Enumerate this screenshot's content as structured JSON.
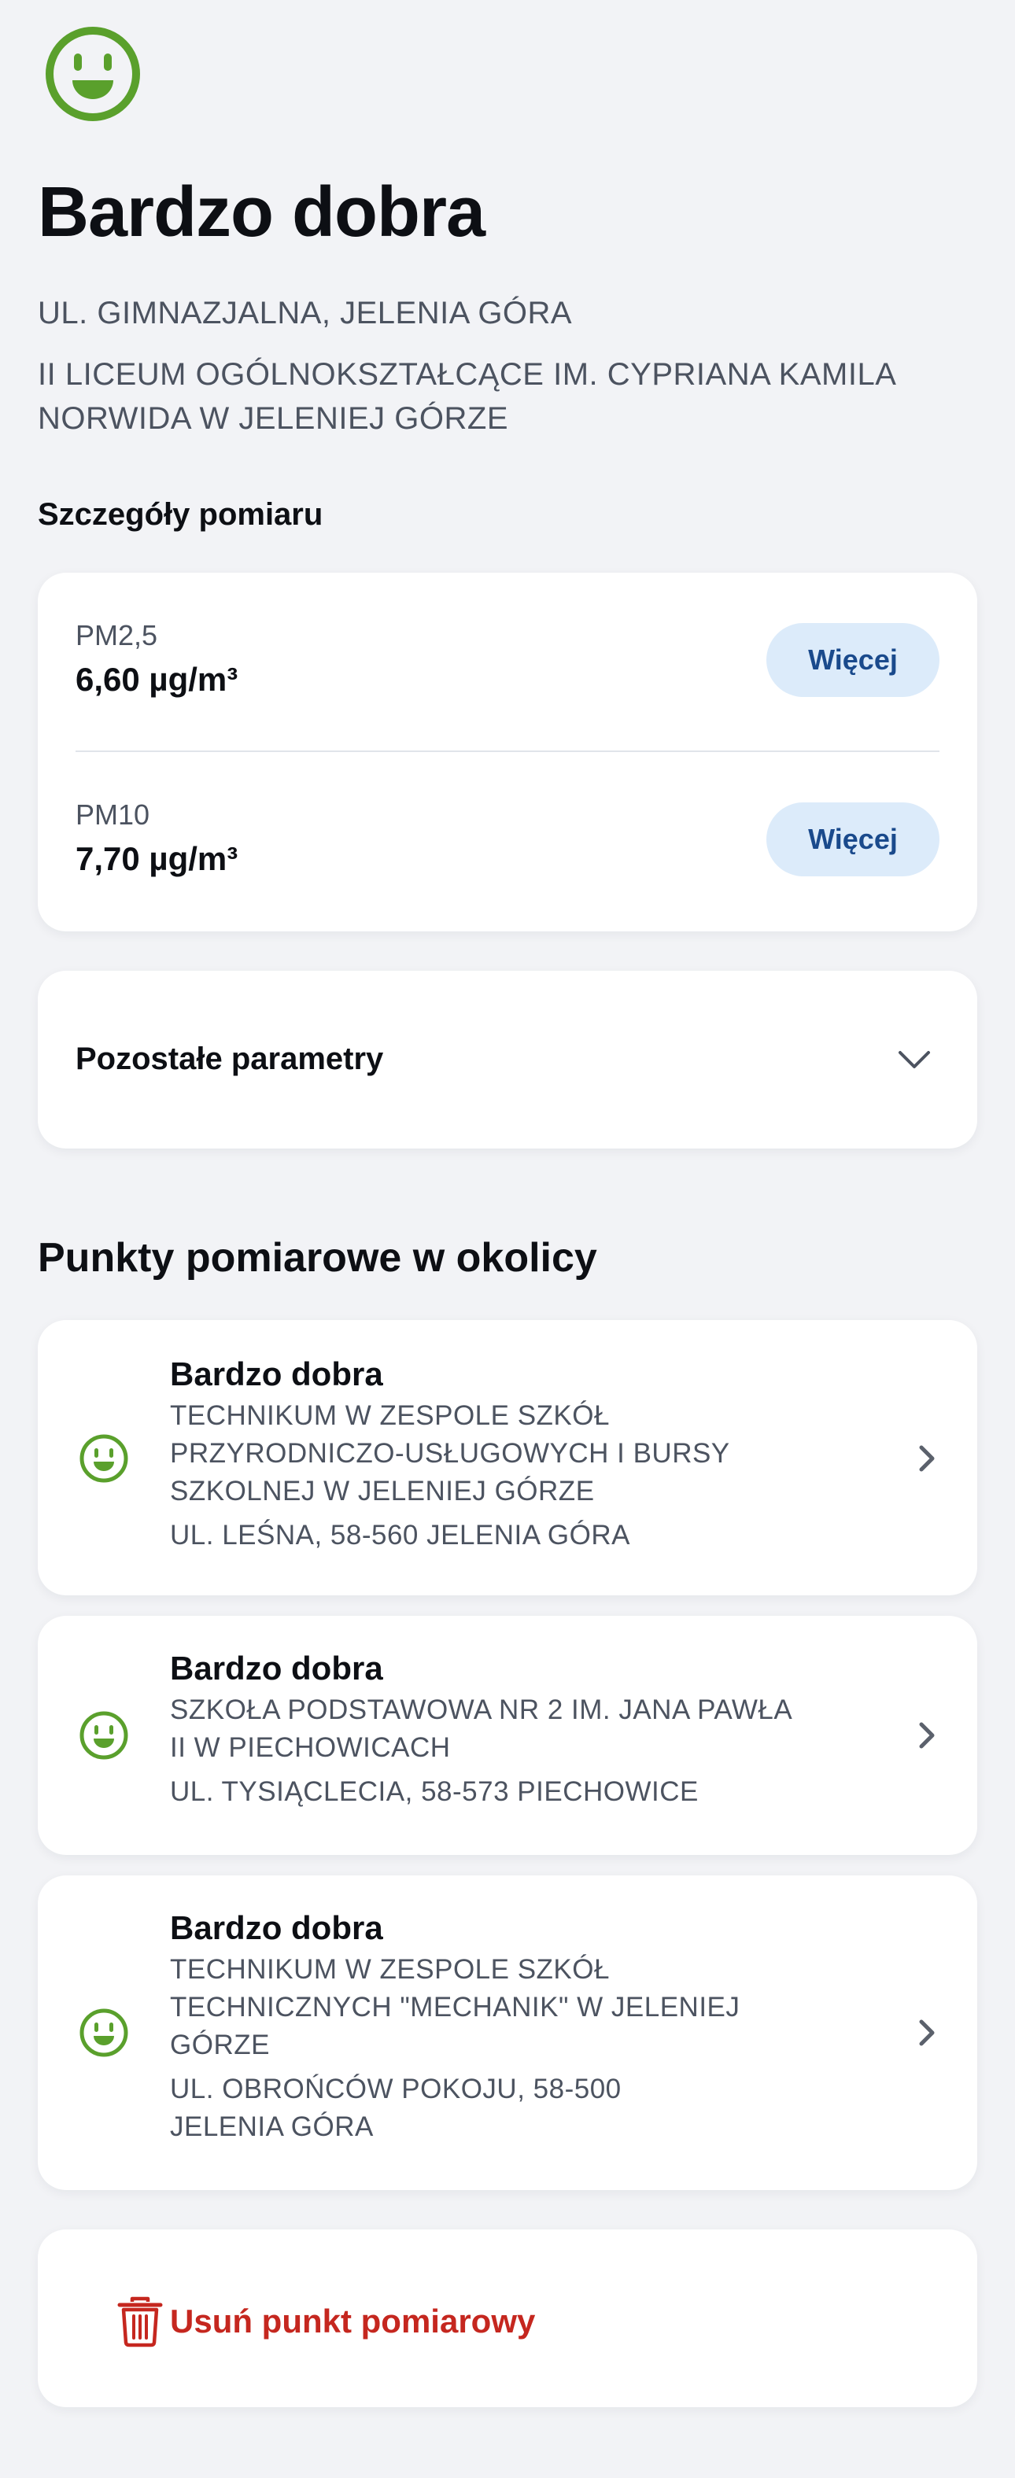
{
  "header": {
    "status_icon": "smiley-face-icon",
    "status_color": "#5aa02c",
    "quality": "Bardzo dobra",
    "address": "UL. GIMNAZJALNA, JELENIA GÓRA",
    "station_name": "II LICEUM OGÓLNOKSZTAŁCĄCE IM. CYPRIANA KAMILA NORWIDA W JELENIEJ GÓRZE"
  },
  "details": {
    "heading": "Szczegóły pomiaru",
    "measurements": [
      {
        "name": "PM2,5",
        "value": "6,60 µg/m³",
        "button": "Więcej"
      },
      {
        "name": "PM10",
        "value": "7,70 µg/m³",
        "button": "Więcej"
      }
    ],
    "other_params": {
      "label": "Pozostałe parametry",
      "icon": "chevron-down-icon"
    }
  },
  "nearby": {
    "heading": "Punkty pomiarowe w okolicy",
    "items": [
      {
        "status": "Bardzo dobra",
        "name_lines": [
          "TECHNIKUM W ZESPOLE SZKÓŁ",
          "PRZYRODNICZO-USŁUGOWYCH I BURSY",
          "SZKOLNEJ W JELENIEJ GÓRZE"
        ],
        "address_lines": [
          "UL. LEŚNA, 58-560 JELENIA GÓRA"
        ],
        "icon": "smiley-face-icon"
      },
      {
        "status": "Bardzo dobra",
        "name_lines": [
          "SZKOŁA PODSTAWOWA NR 2 IM. JANA PAWŁA",
          "II W PIECHOWICACH"
        ],
        "address_lines": [
          "UL. TYSIĄCLECIA, 58-573 PIECHOWICE"
        ],
        "icon": "smiley-face-icon"
      },
      {
        "status": "Bardzo dobra",
        "name_lines": [
          "TECHNIKUM W ZESPOLE SZKÓŁ",
          "TECHNICZNYCH \"MECHANIK\" W JELENIEJ",
          "GÓRZE"
        ],
        "address_lines": [
          "UL. OBROŃCÓW POKOJU, 58-500",
          "JELENIA GÓRA"
        ],
        "icon": "smiley-face-icon"
      }
    ]
  },
  "delete": {
    "label": "Usuń punkt pomiarowy",
    "icon": "trash-icon",
    "color": "#c5271f"
  }
}
